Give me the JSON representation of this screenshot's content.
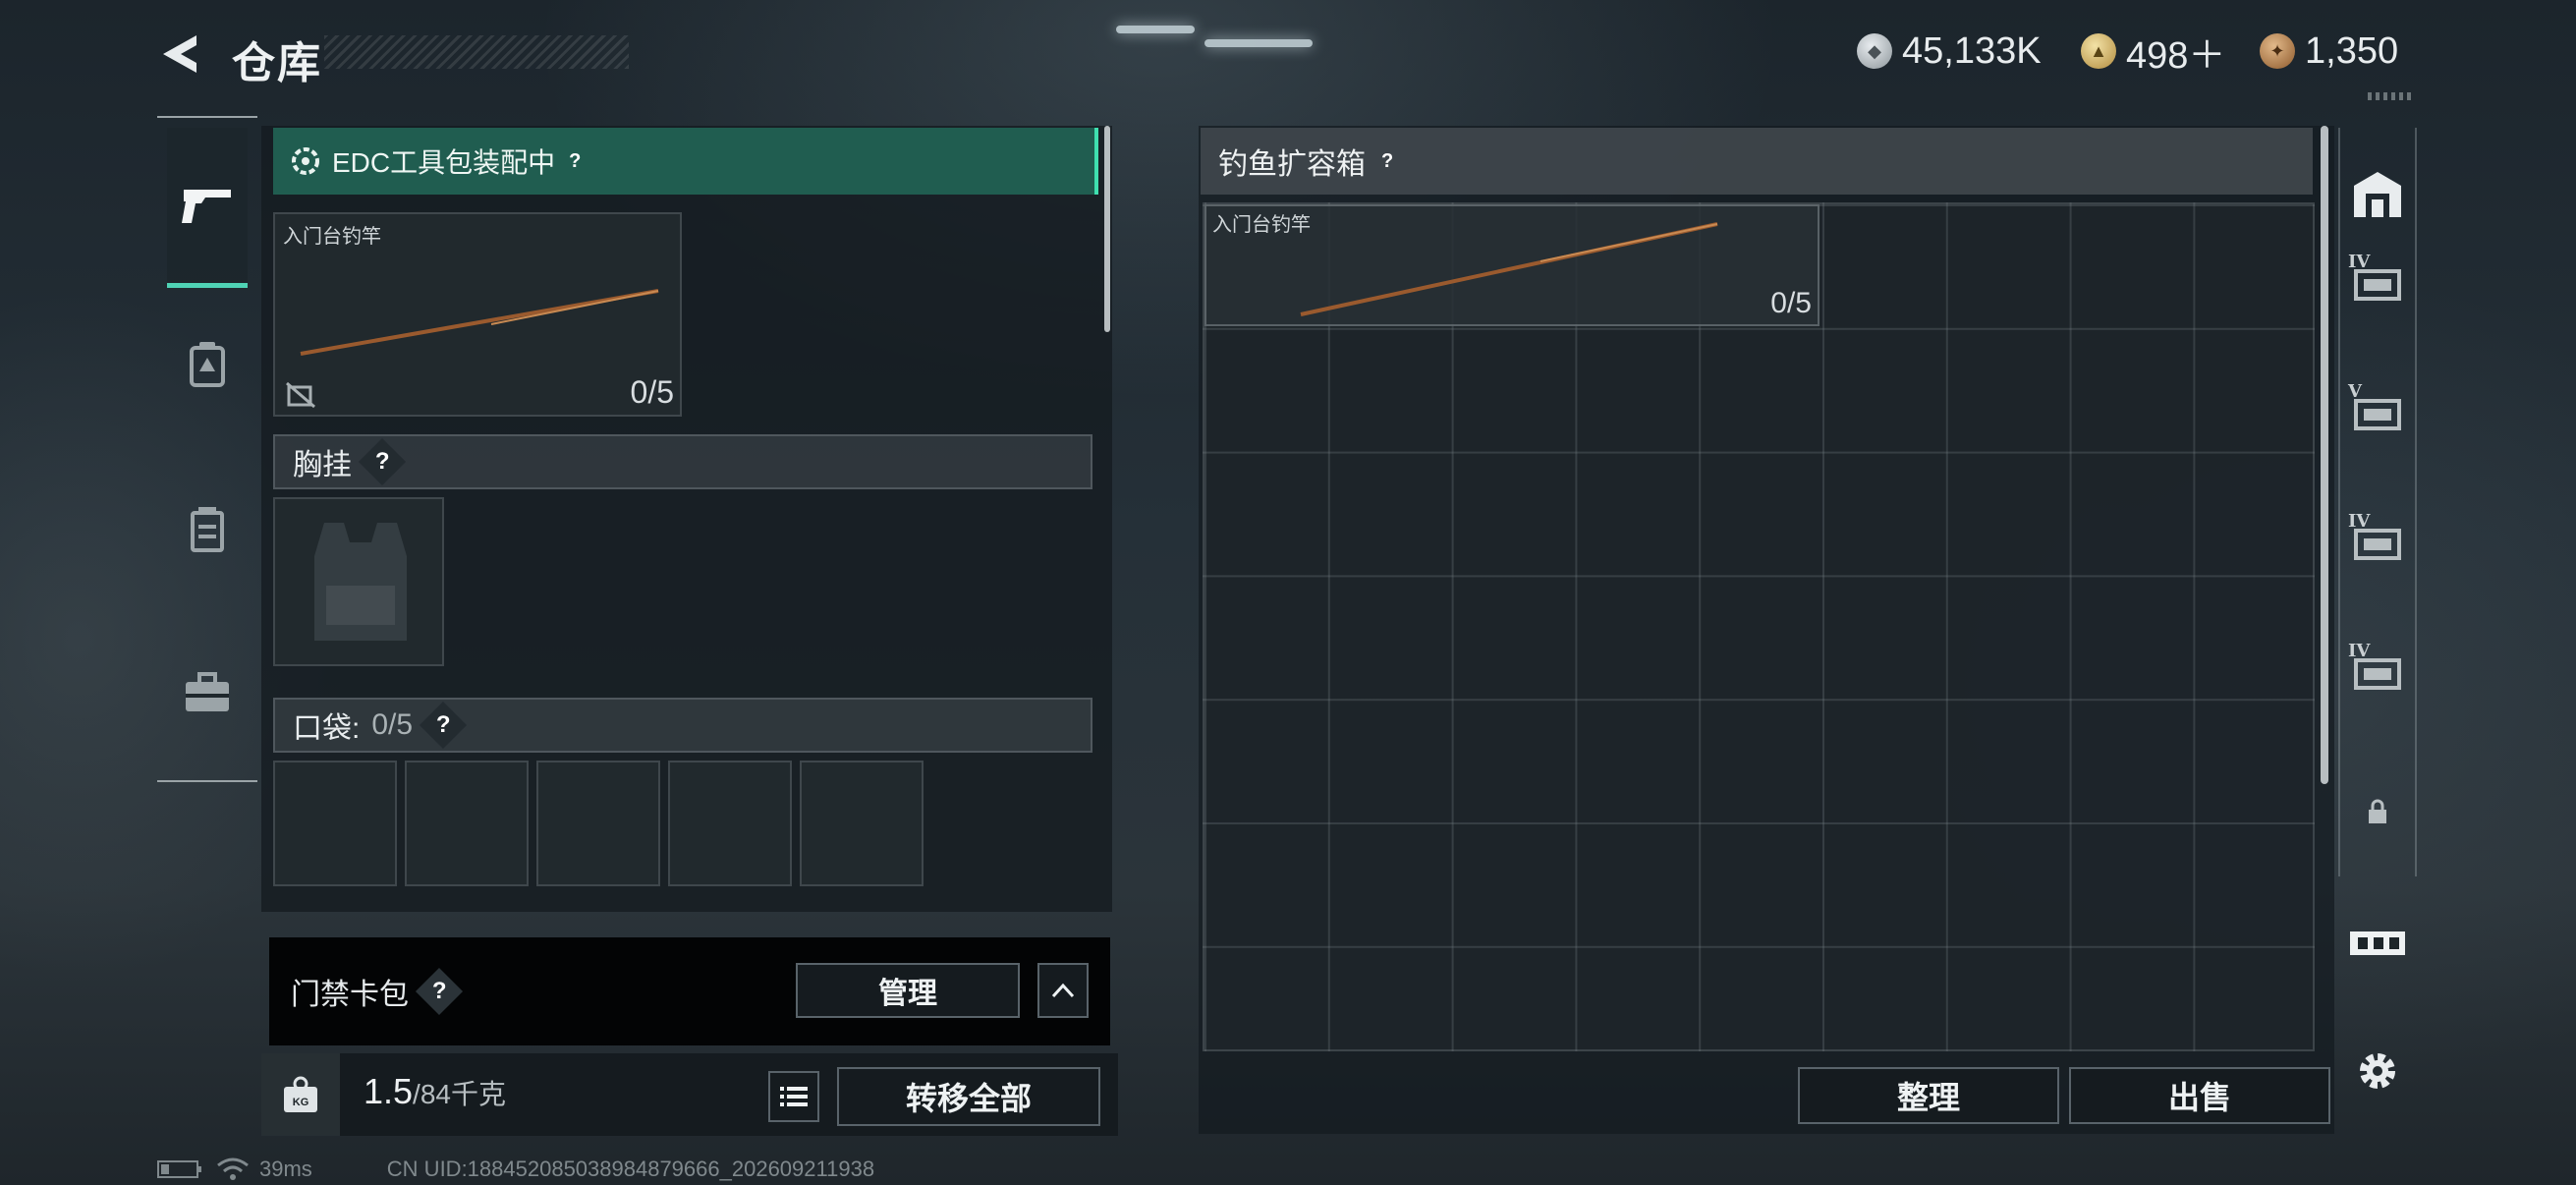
{
  "header": {
    "title": "仓库",
    "currencies": [
      {
        "icon": "silver-coin-icon",
        "value": "45,133K"
      },
      {
        "icon": "gold-triangle-icon",
        "value": "498＋"
      },
      {
        "icon": "bronze-coin-icon",
        "value": "1,350"
      }
    ]
  },
  "left_rail": {
    "items": [
      "weapon-icon",
      "backpack-icon",
      "vest-icon",
      "toolbox-icon"
    ]
  },
  "left": {
    "edc_label": "EDC工具包装配中",
    "edc_help": "?",
    "rod_name": "入门台钓竿",
    "rod_count": "0/5",
    "chest_label": "胸挂",
    "chest_help": "?",
    "pocket_label": "口袋:",
    "pocket_count": "0/5",
    "pocket_help": "?"
  },
  "keycard": {
    "label": "门禁卡包",
    "help": "?",
    "manage_label": "管理"
  },
  "bottom": {
    "weight_value": "1.5",
    "weight_total": "/84千克",
    "transfer_label": "转移全部"
  },
  "right": {
    "title": "钓鱼扩容箱",
    "help": "?",
    "item_name": "入门台钓竿",
    "item_count": "0/5",
    "sort_label": "整理",
    "sell_label": "出售"
  },
  "right_rail": {
    "tiers": [
      "IV",
      "V",
      "IV",
      "IV"
    ]
  },
  "status_bar": {
    "ping": "39ms",
    "uid": "CN UID:188452085038984879666_202609211938"
  },
  "colors": {
    "accent_teal": "#3fe0b0",
    "edc_bg": "#205d50",
    "panel": "#141b20"
  }
}
